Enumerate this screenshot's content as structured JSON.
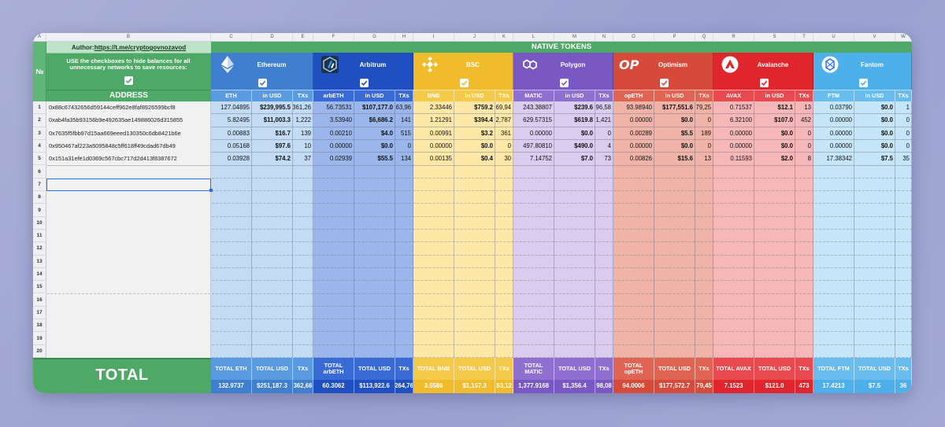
{
  "sheet": {
    "col_letters": [
      "A",
      "B",
      "C",
      "D",
      "E",
      "F",
      "G",
      "H",
      "I",
      "J",
      "K",
      "L",
      "M",
      "N",
      "O",
      "P",
      "Q",
      "R",
      "S",
      "T",
      "U",
      "V",
      "W"
    ],
    "author_label": "Author: ",
    "author_link": "https://t.me/cryptogovnozavod",
    "number_header": "№",
    "hint_text": "USE the checkboxes to hide balances for all unnecessary networks to save resources:",
    "address_header": "ADDRESS",
    "native_tokens_header": "NATIVE TOKENS",
    "total_label": "TOTAL",
    "row_numbers": [
      "1",
      "2",
      "3",
      "4",
      "5",
      "6",
      "7",
      "8",
      "9",
      "10",
      "11",
      "12",
      "13",
      "14",
      "15",
      "16",
      "17",
      "18",
      "19",
      "20"
    ]
  },
  "addresses": [
    "0x88c67432656d59144ceff962e8faf8926599bcf8",
    "0xab4fa35b93156b9e492635ae149886026d315855",
    "0x7635f5fbb97d15aa669eeed130350c6db8421b6e",
    "0x950467af223a5095848c5ff618ff49cdad67db49",
    "0x151a31efe1d0369c567cbc717d2d413f8387672"
  ],
  "networks": [
    {
      "name": "Ethereum",
      "icon": "ethereum-logo-icon",
      "bg": "#3f7fcd",
      "light": "#c4dcf3",
      "sub": [
        "ETH",
        "in USD",
        "TXs"
      ],
      "sub_bg": "#5a9ae0",
      "rows": [
        [
          "127.04895",
          "$239,995.5",
          "361,26"
        ],
        [
          "5.82495",
          "$11,003.3",
          "1,222"
        ],
        [
          "0.00883",
          "$16.7",
          "139"
        ],
        [
          "0.05168",
          "$97.6",
          "10"
        ],
        [
          "0.03928",
          "$74.2",
          "37"
        ]
      ],
      "tot_labels": [
        "TOTAL ETH",
        "TOTAL USD",
        "TXs"
      ],
      "totals": [
        "132.9737",
        "$251,187.3",
        "362,66"
      ]
    },
    {
      "name": "Arbitrum",
      "icon": "arbitrum-logo-icon",
      "bg": "#1f4fc0",
      "light": "#9bb6ea",
      "sub": [
        "arbETH",
        "in USD",
        "TXs"
      ],
      "sub_bg": "#3a6ad6",
      "rows": [
        [
          "56.73531",
          "$107,177.0",
          "263,96"
        ],
        [
          "3.53940",
          "$6,686.2",
          "141"
        ],
        [
          "0.00210",
          "$4.0",
          "515"
        ],
        [
          "0.00000",
          "$0.0",
          "0"
        ],
        [
          "0.02939",
          "$55.5",
          "134"
        ]
      ],
      "tot_labels": [
        "TOTAL arbETH",
        "TOTAL USD",
        "TXs"
      ],
      "totals": [
        "60.3062",
        "$113,922.6",
        "264,76"
      ]
    },
    {
      "name": "BSC",
      "icon": "bnb-logo-icon",
      "bg": "#f0bc2c",
      "light": "#fde8a8",
      "sub": [
        "BNB",
        "in USD",
        "TXs"
      ],
      "sub_bg": "#f5c94a",
      "rows": [
        [
          "2.33446",
          "$759.2",
          "69,94"
        ],
        [
          "1.21291",
          "$394.4",
          "12,787"
        ],
        [
          "0.00991",
          "$3.2",
          "361"
        ],
        [
          "0.00000",
          "$0.0",
          "0"
        ],
        [
          "0.00135",
          "$0.4",
          "30"
        ]
      ],
      "tot_labels": [
        "TOTAL BNB",
        "TOTAL USD",
        "TXs"
      ],
      "totals": [
        "3.5586",
        "$1,157.3",
        "83,12"
      ]
    },
    {
      "name": "Polygon",
      "icon": "polygon-logo-icon",
      "bg": "#7a58c4",
      "light": "#d9ccee",
      "sub": [
        "MATIC",
        "in USD",
        "TXs"
      ],
      "sub_bg": "#8f6fd0",
      "rows": [
        [
          "243.38807",
          "$239.6",
          "96,58"
        ],
        [
          "629.57315",
          "$619.8",
          "1,421"
        ],
        [
          "0.00000",
          "$0.0",
          "0"
        ],
        [
          "497.80810",
          "$490.0",
          "4"
        ],
        [
          "7.14752",
          "$7.0",
          "73"
        ]
      ],
      "tot_labels": [
        "TOTAL MATIC",
        "TOTAL USD",
        "TXs"
      ],
      "totals": [
        "1,377.9168",
        "$1,356.4",
        "98,08"
      ]
    },
    {
      "name": "Optimism",
      "icon": "optimism-logo-icon",
      "bg": "#d64a3a",
      "light": "#f0b3a8",
      "sub": [
        "opETH",
        "in USD",
        "TXs"
      ],
      "sub_bg": "#df6454",
      "rows": [
        [
          "93.98940",
          "$177,551.6",
          "79,25"
        ],
        [
          "0.00000",
          "$0.0",
          "0"
        ],
        [
          "0.00289",
          "$5.5",
          "189"
        ],
        [
          "0.00000",
          "$0.0",
          "0"
        ],
        [
          "0.00826",
          "$15.6",
          "13"
        ]
      ],
      "tot_labels": [
        "TOTAL opETH",
        "TOTAL USD",
        "TXs"
      ],
      "totals": [
        "94.0006",
        "$177,572.7",
        "79,45"
      ]
    },
    {
      "name": "Avalanche",
      "icon": "avalanche-logo-icon",
      "bg": "#e0262c",
      "light": "#f6b7b9",
      "sub": [
        "AVAX",
        "in USD",
        "TXs"
      ],
      "sub_bg": "#e84a4f",
      "rows": [
        [
          "0.71537",
          "$12.1",
          "13"
        ],
        [
          "6.32100",
          "$107.0",
          "452"
        ],
        [
          "0.00000",
          "$0.0",
          "0"
        ],
        [
          "0.00000",
          "$0.0",
          "0"
        ],
        [
          "0.11593",
          "$2.0",
          "8"
        ]
      ],
      "tot_labels": [
        "TOTAL AVAX",
        "TOTAL USD",
        "TXs"
      ],
      "totals": [
        "7.1523",
        "$121.0",
        "473"
      ]
    },
    {
      "name": "Fantom",
      "icon": "fantom-logo-icon",
      "bg": "#4eb0ea",
      "light": "#c5e6f8",
      "sub": [
        "FTM",
        "in USD",
        "TXs"
      ],
      "sub_bg": "#68bdee",
      "rows": [
        [
          "0.03790",
          "$0.0",
          "1"
        ],
        [
          "0.00000",
          "$0.0",
          "0"
        ],
        [
          "0.00000",
          "$0.0",
          "0"
        ],
        [
          "0.00000",
          "$0.0",
          "0"
        ],
        [
          "17.38342",
          "$7.5",
          "35"
        ]
      ],
      "tot_labels": [
        "TOTAL FTM",
        "TOTAL USD",
        "TXs"
      ],
      "totals": [
        "17.4213",
        "$7.5",
        "36"
      ]
    }
  ]
}
